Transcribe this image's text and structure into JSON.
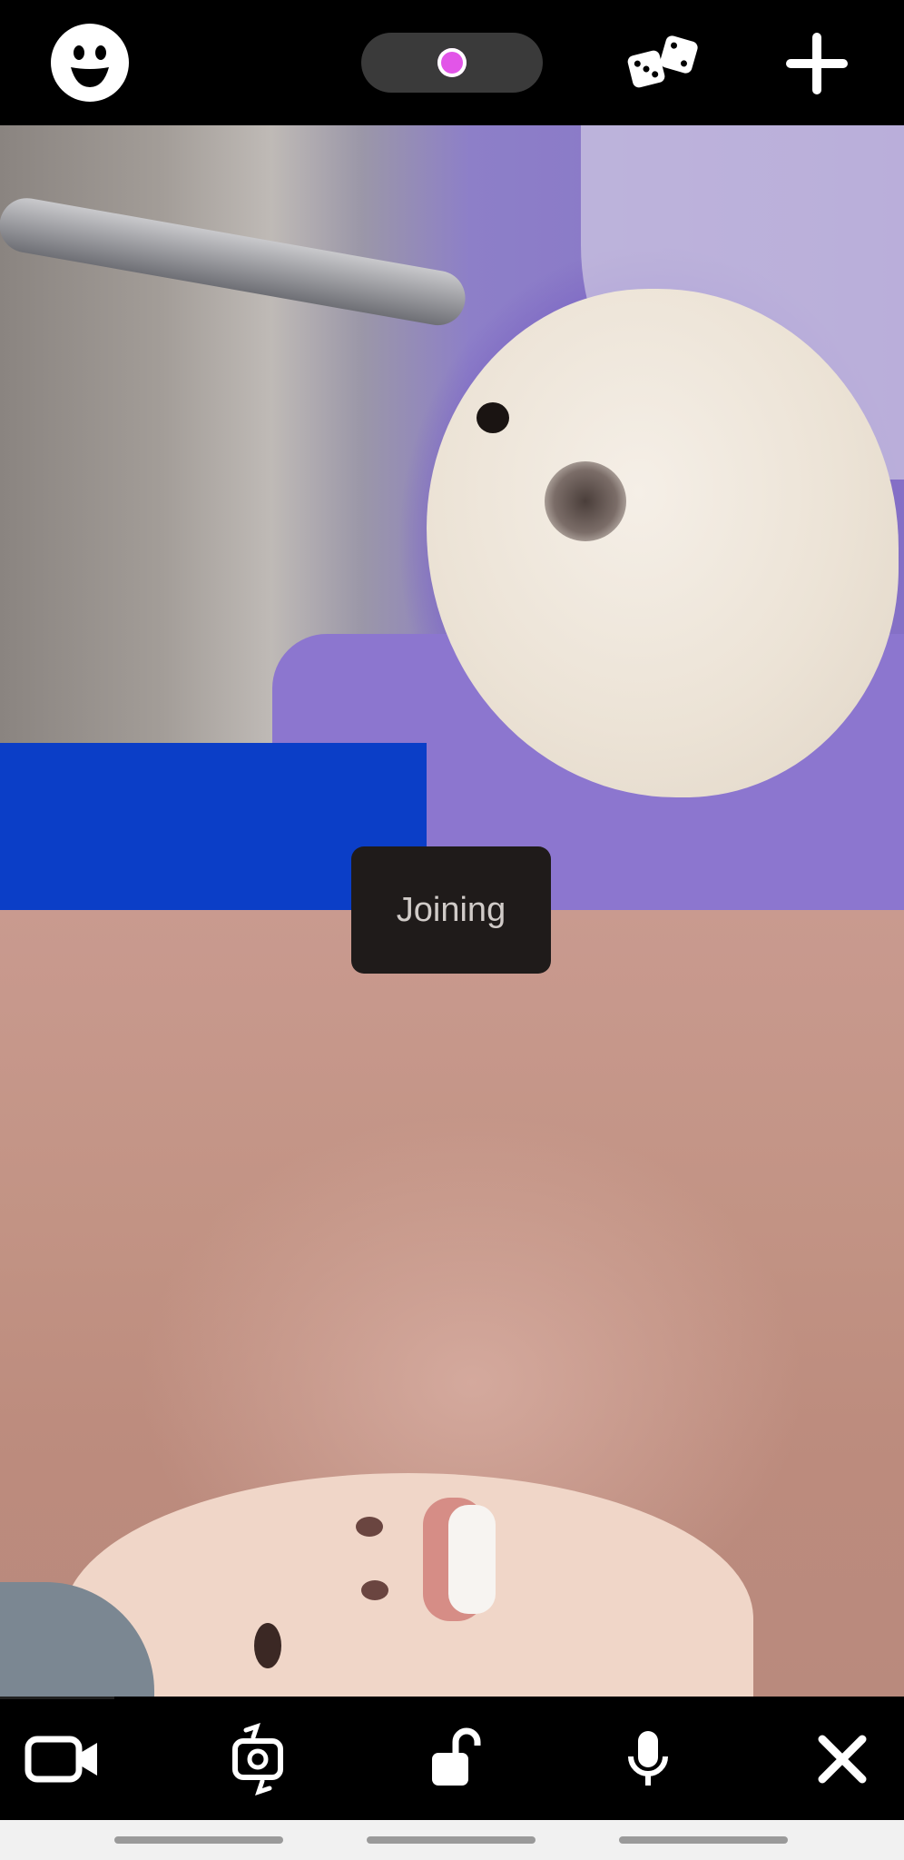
{
  "status": {
    "toast_label": "Joining"
  },
  "top_bar": {
    "smiley_icon": "smiley-face-icon",
    "record_indicator_icon": "record-dot-icon",
    "dice_icon": "dice-icon",
    "add_icon": "plus-icon"
  },
  "colors": {
    "record_dot": "#e255e8",
    "background": "#000000",
    "toast_bg": "#1f1b1a"
  },
  "controls": {
    "camera_icon": "video-camera-icon",
    "flip_icon": "camera-flip-icon",
    "lock_icon": "unlock-icon",
    "mic_icon": "microphone-icon",
    "close_icon": "close-icon"
  }
}
